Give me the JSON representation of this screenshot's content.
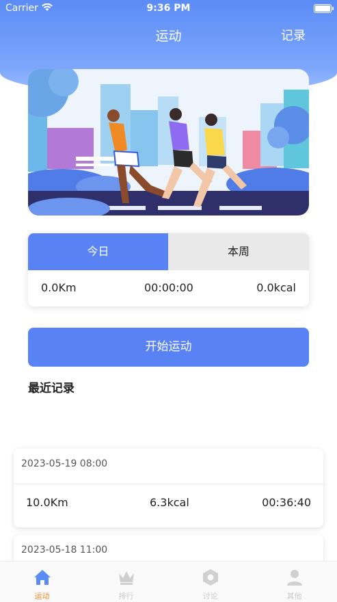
{
  "status_bar": {
    "carrier": "Carrier",
    "time": "9:36 PM"
  },
  "nav": {
    "title": "运动",
    "right_action": "记录"
  },
  "stats": {
    "tabs": [
      "今日",
      "本周"
    ],
    "active_tab": "今日",
    "distance": "0.0Km",
    "duration": "00:00:00",
    "calories": "0.0kcal"
  },
  "start_button": "开始运动",
  "recent_title": "最近记录",
  "records": [
    {
      "date": "2023-05-19 08:00",
      "distance": "10.0Km",
      "calories": "6.3kcal",
      "duration": "00:36:40"
    },
    {
      "date": "2023-05-18 11:00"
    }
  ],
  "tabbar": [
    {
      "label": "运动",
      "icon": "home-icon"
    },
    {
      "label": "排行",
      "icon": "crown-icon"
    },
    {
      "label": "讨论",
      "icon": "hexagon-icon"
    },
    {
      "label": "其他",
      "icon": "person-icon"
    }
  ],
  "colors": {
    "primary": "#5983f5",
    "active_tab": "#f08a24",
    "inactive_tab": "#c9c9c9"
  }
}
